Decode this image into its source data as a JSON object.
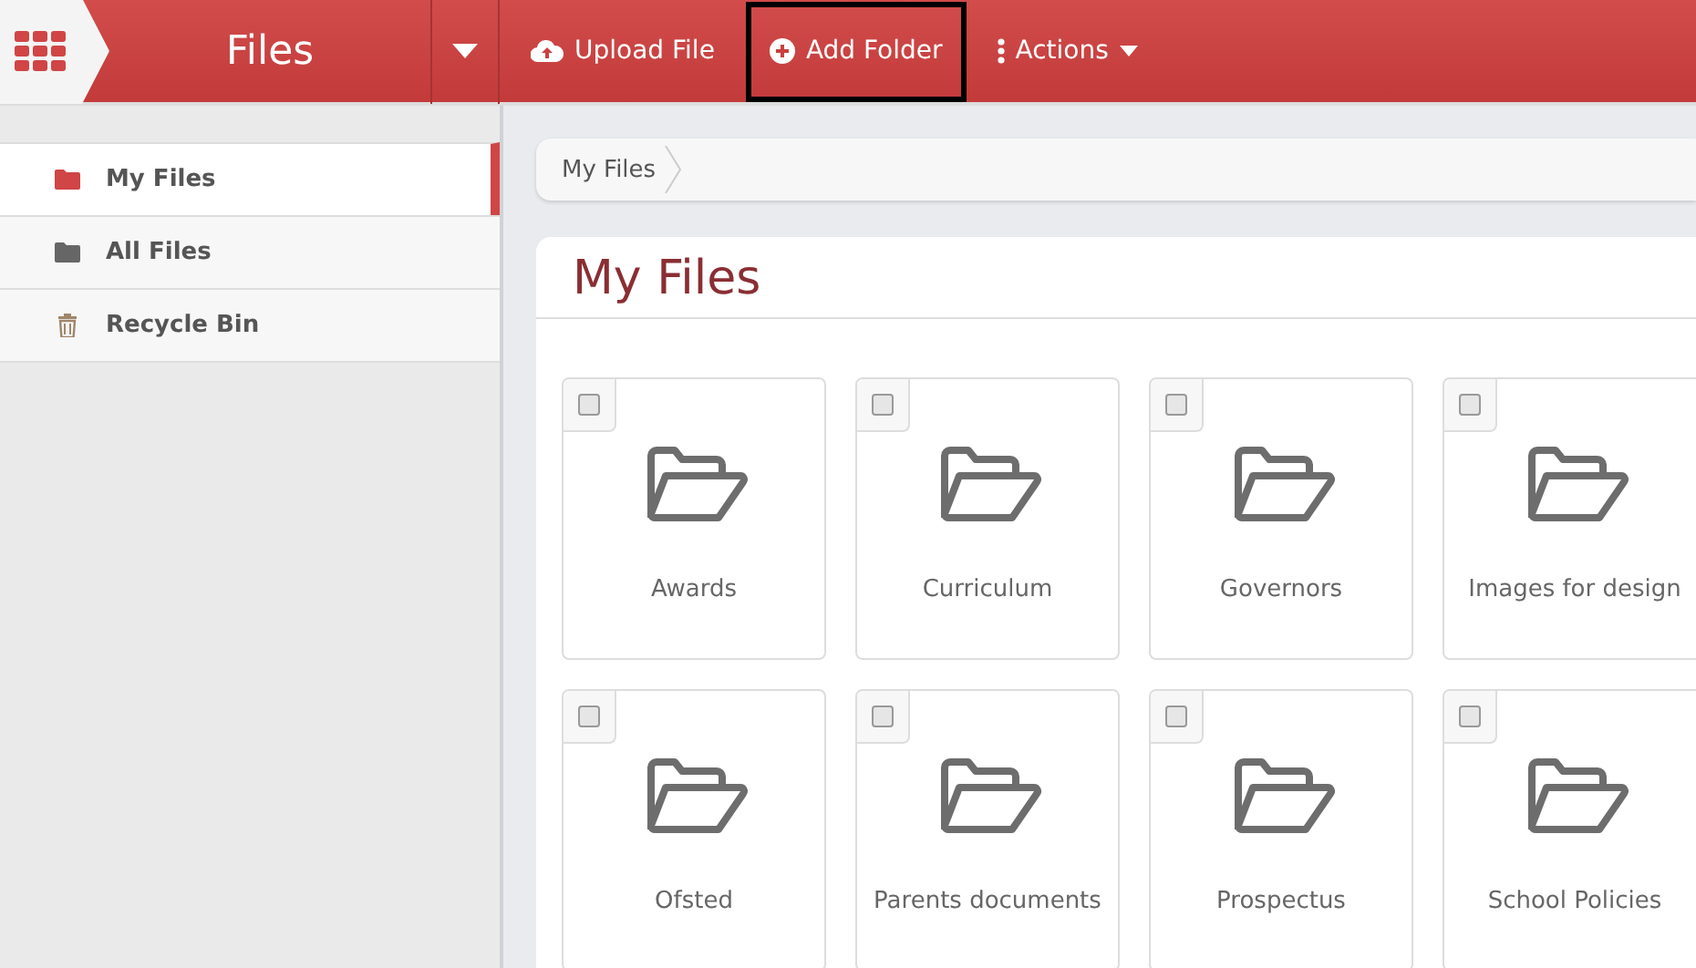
{
  "topbar": {
    "title": "Files",
    "buttons": [
      {
        "kind": "upload",
        "label": "Upload File",
        "highlighted": false
      },
      {
        "kind": "add",
        "label": "Add Folder",
        "highlighted": true
      },
      {
        "kind": "actions",
        "label": "Actions",
        "highlighted": false
      }
    ]
  },
  "sidebar": {
    "items": [
      {
        "kind": "folder",
        "label": "My Files",
        "selected": true
      },
      {
        "kind": "folder",
        "label": "All Files",
        "selected": false
      },
      {
        "kind": "bin",
        "label": "Recycle Bin",
        "selected": false
      }
    ]
  },
  "breadcrumb": [
    "My Files"
  ],
  "heading": "My Files",
  "folders": [
    {
      "name": "Awards",
      "checked": false
    },
    {
      "name": "Curriculum",
      "checked": false
    },
    {
      "name": "Governors",
      "checked": false
    },
    {
      "name": "Images for design",
      "checked": false
    },
    {
      "name": "Ofsted",
      "checked": false
    },
    {
      "name": "Parents documents",
      "checked": false
    },
    {
      "name": "Prospectus",
      "checked": false
    },
    {
      "name": "School Policies",
      "checked": false
    }
  ]
}
